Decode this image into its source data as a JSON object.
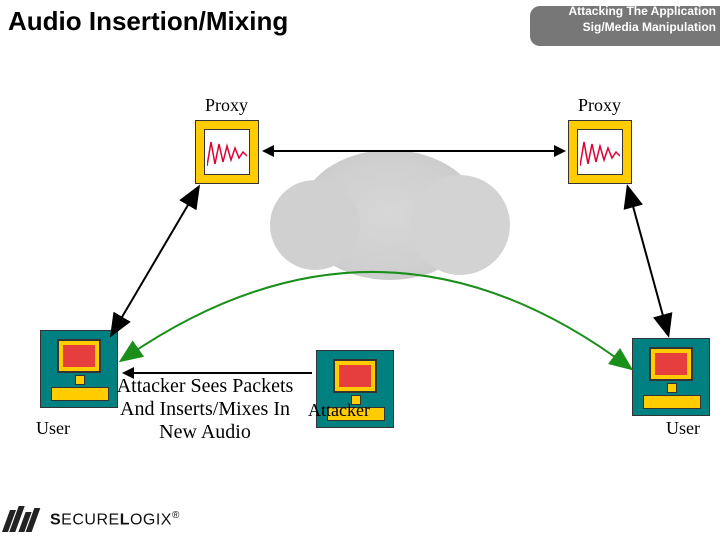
{
  "title": "Audio Insertion/Mixing",
  "badge": {
    "line1": "Attacking The Application",
    "line2": "Sig/Media Manipulation"
  },
  "labels": {
    "proxy_left": "Proxy",
    "proxy_right": "Proxy",
    "user_left": "User",
    "user_right": "User",
    "attacker": "Attacker",
    "attacker_desc": "Attacker Sees Packets And Inserts/Mixes In New Audio"
  },
  "logo": {
    "brand_strong": "S",
    "brand_rest": "ECURE",
    "brand_strong2": "L",
    "brand_rest2": "OGIX",
    "reg": "®"
  },
  "colors": {
    "accent": "#ffcc00",
    "teal": "#008080",
    "green_curve": "#1a8f1a"
  }
}
